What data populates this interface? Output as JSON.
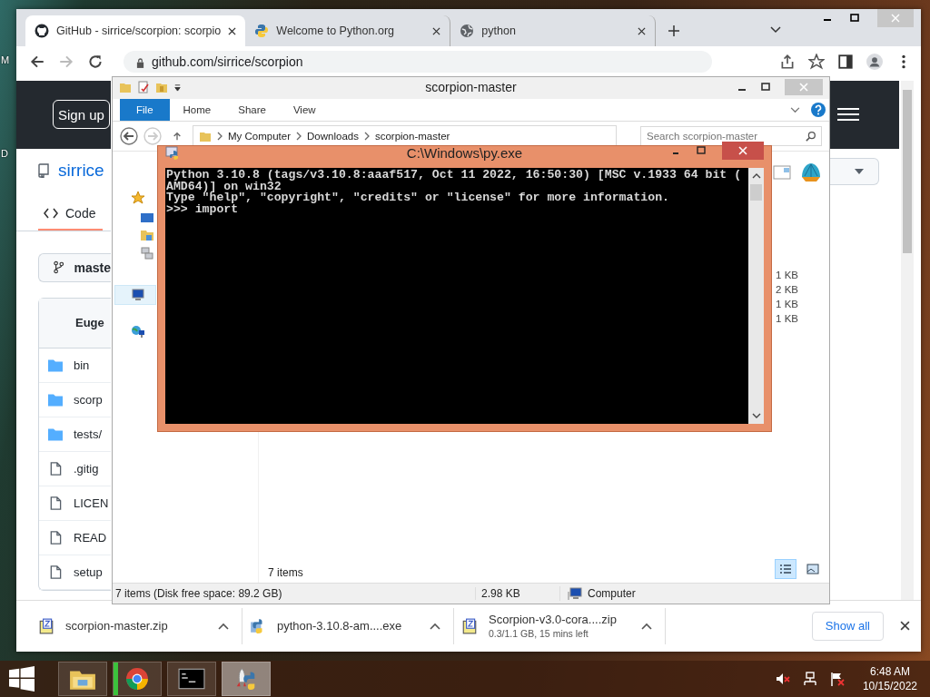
{
  "desktop": {
    "edge_labels": [
      "M",
      "D"
    ]
  },
  "browser": {
    "tabs": [
      {
        "title": "GitHub - sirrice/scorpion: scorpio",
        "kind": "github",
        "selected": true
      },
      {
        "title": "Welcome to Python.org",
        "kind": "python",
        "selected": false
      },
      {
        "title": "python",
        "kind": "globe",
        "selected": false
      }
    ],
    "address": "github.com/sirrice/scorpion",
    "page": {
      "signup": "Sign up",
      "repo_owner": "sirrice",
      "tabs": [
        {
          "label": "Code",
          "selected": true
        }
      ],
      "branch": "maste",
      "commit_author": "Euge",
      "files": [
        {
          "name": "bin",
          "kind": "folder"
        },
        {
          "name": "scorp",
          "kind": "folder"
        },
        {
          "name": "tests/",
          "kind": "folder"
        },
        {
          "name": ".gitig",
          "kind": "file"
        },
        {
          "name": "LICEN",
          "kind": "file"
        },
        {
          "name": "READ",
          "kind": "file"
        },
        {
          "name": "setup",
          "kind": "file"
        }
      ]
    },
    "downloads": [
      {
        "name": "scorpion-master.zip",
        "kind": "zip"
      },
      {
        "name": "python-3.10.8-am....exe",
        "kind": "installer"
      },
      {
        "name": "Scorpion-v3.0-cora....zip",
        "kind": "zip",
        "progress": "0.3/1.1 GB, 15 mins left"
      }
    ],
    "show_all": "Show all"
  },
  "explorer": {
    "title": "scorpion-master",
    "ribbon_tabs": [
      {
        "label": "File",
        "selected": true
      },
      {
        "label": "Home",
        "selected": false
      },
      {
        "label": "Share",
        "selected": false
      },
      {
        "label": "View",
        "selected": false
      }
    ],
    "path": [
      "My Computer",
      "Downloads",
      "scorpion-master"
    ],
    "search": {
      "placeholder": "Search scorpion-master"
    },
    "sizes": [
      "1 KB",
      "2 KB",
      "1 KB",
      "1 KB"
    ],
    "item_count": "7 items",
    "status_items": "7 items (Disk free space: 89.2 GB)",
    "status_size": "2.98 KB",
    "status_location": "Computer",
    "views": [
      {
        "kind": "details",
        "selected": true
      },
      {
        "kind": "large-icons",
        "selected": false
      }
    ]
  },
  "console": {
    "title": "C:\\Windows\\py.exe",
    "lines": [
      "Python 3.10.8 (tags/v3.10.8:aaaf517, Oct 11 2022, 16:50:30) [MSC v.1933 64 bit (",
      "AMD64)] on win32",
      "Type \"help\", \"copyright\", \"credits\" or \"license\" for more information.",
      ">>> import"
    ]
  },
  "taskbar": {
    "items": [
      {
        "kind": "explorer",
        "active": false
      },
      {
        "kind": "chrome",
        "active": false,
        "level": 0.1
      },
      {
        "kind": "console",
        "active": false
      },
      {
        "kind": "python-launcher",
        "active": true
      }
    ],
    "time": "6:48 AM",
    "date": "10/15/2022"
  }
}
